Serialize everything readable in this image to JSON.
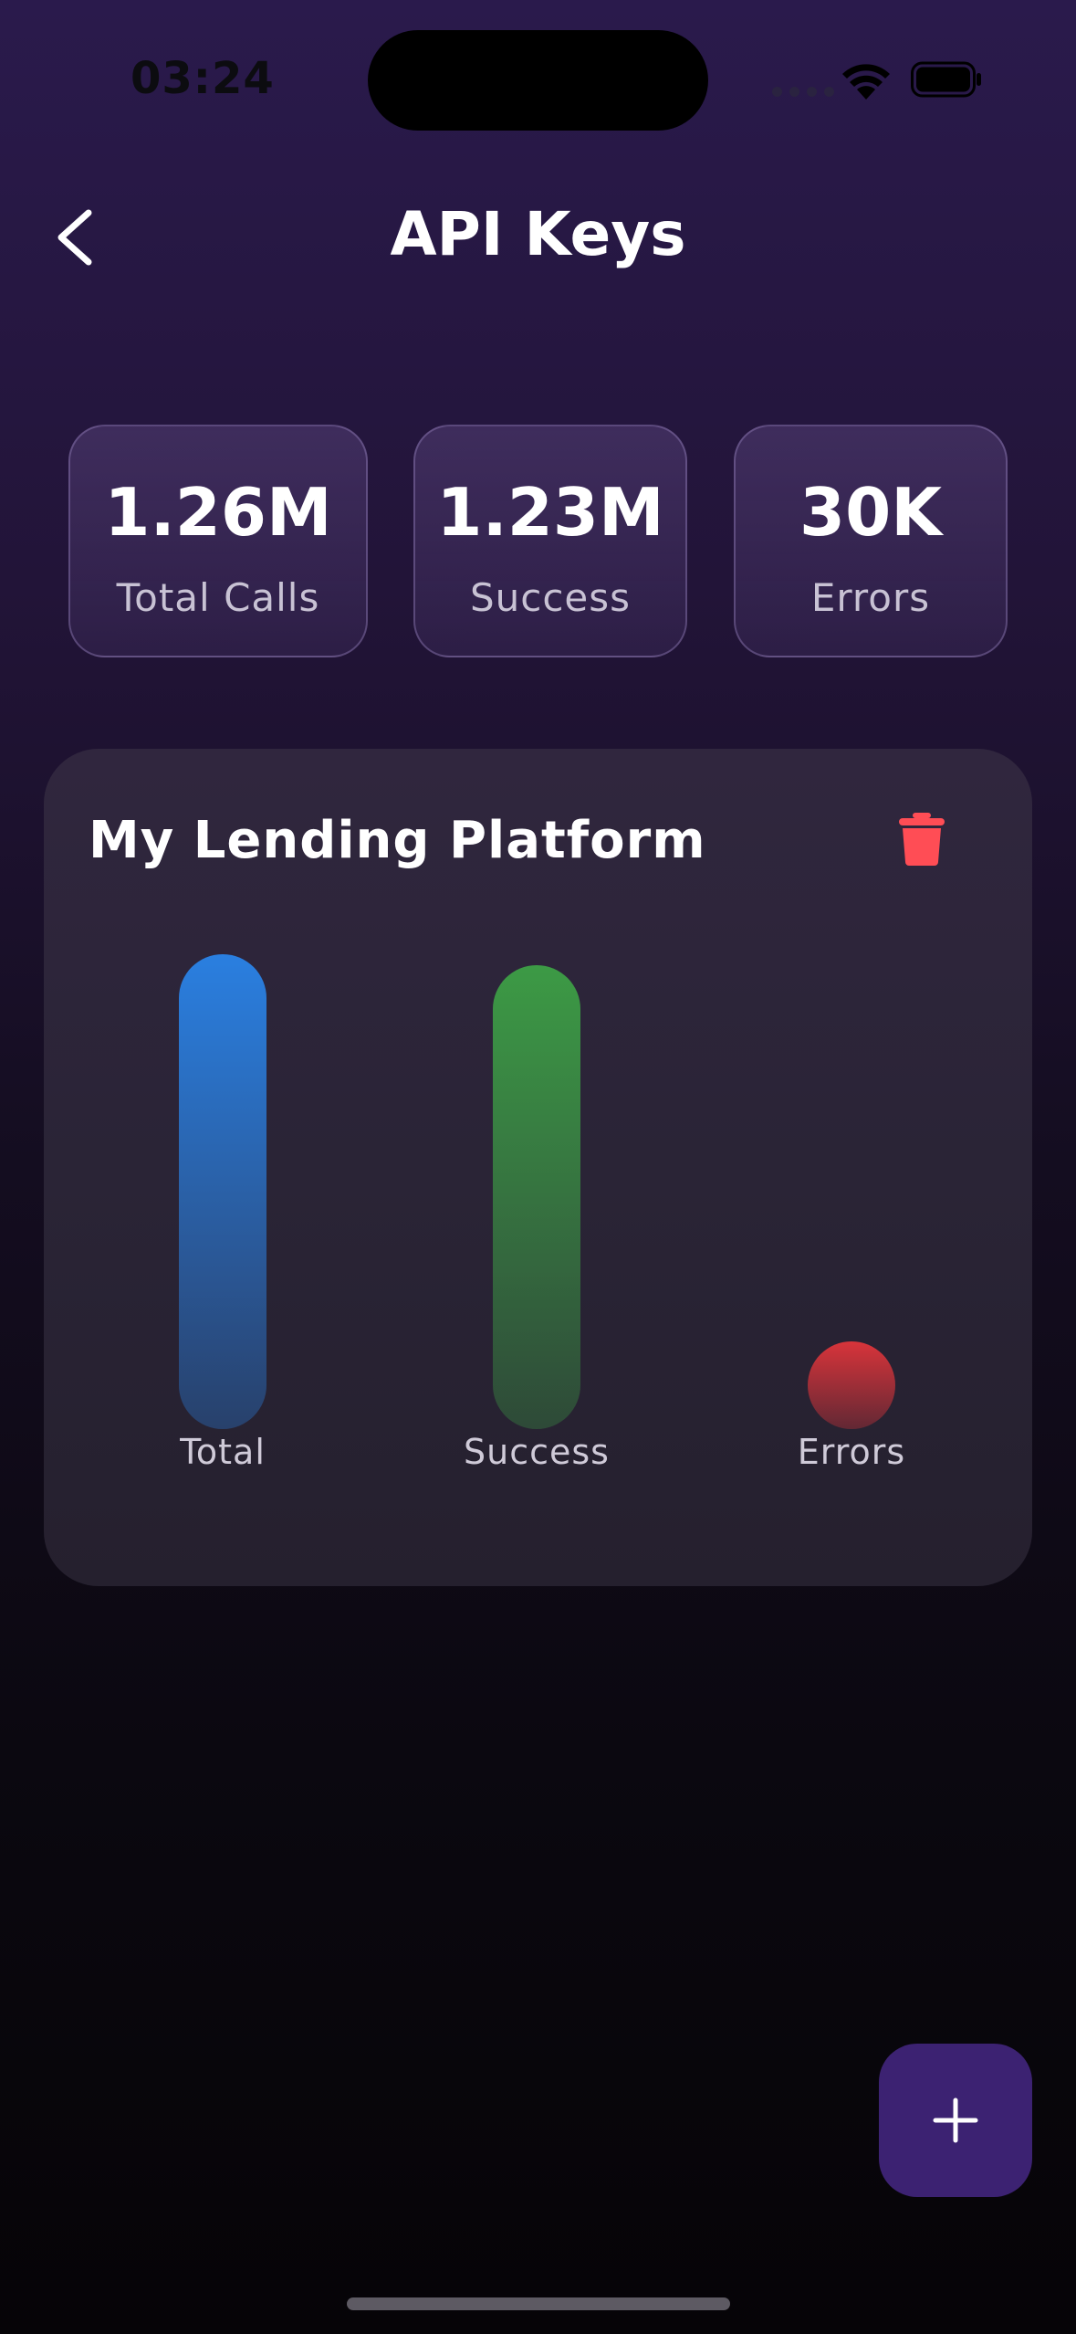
{
  "status_bar": {
    "time": "03:24"
  },
  "header": {
    "title": "API Keys"
  },
  "stats": [
    {
      "value": "1.26M",
      "label": "Total Calls"
    },
    {
      "value": "1.23M",
      "label": "Success"
    },
    {
      "value": "30K",
      "label": "Errors"
    }
  ],
  "api_key_card": {
    "name": "My Lending Platform",
    "chart_data": {
      "type": "bar",
      "categories": [
        "Total",
        "Success",
        "Errors"
      ],
      "values": [
        1260000,
        1230000,
        30000
      ],
      "colors": [
        "#2a7fe0",
        "#3c9a45",
        "#d8343a"
      ]
    }
  },
  "icons": {
    "back": "chevron-left-icon",
    "delete": "trash-icon",
    "add": "plus-icon",
    "wifi": "wifi-icon",
    "battery": "battery-icon"
  },
  "colors": {
    "accent": "#3c2272",
    "danger": "#ff4d55",
    "background_top": "#2a1a4c",
    "background_bottom": "#060407"
  }
}
